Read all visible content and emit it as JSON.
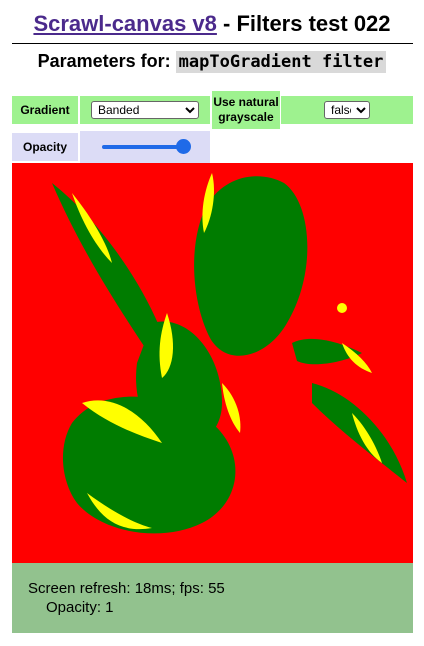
{
  "header": {
    "link_text": "Scrawl-canvas v8",
    "title_rest": " - Filters test 022"
  },
  "subheader": {
    "prefix": "Parameters for: ",
    "filter_name": "mapToGradient filter"
  },
  "controls": {
    "gradient_label": "Gradient",
    "gradient_value": "Banded",
    "natural_label_line1": "Use natural",
    "natural_label_line2": "grayscale",
    "natural_value": "false",
    "opacity_label": "Opacity",
    "opacity_value": 1
  },
  "canvas": {
    "colors": {
      "background": "#ff0000",
      "leaf": "#007c00",
      "highlight": "#ffff00"
    }
  },
  "status": {
    "refresh_line": "Screen refresh: 18ms; fps: 55",
    "opacity_line": "Opacity: 1"
  }
}
